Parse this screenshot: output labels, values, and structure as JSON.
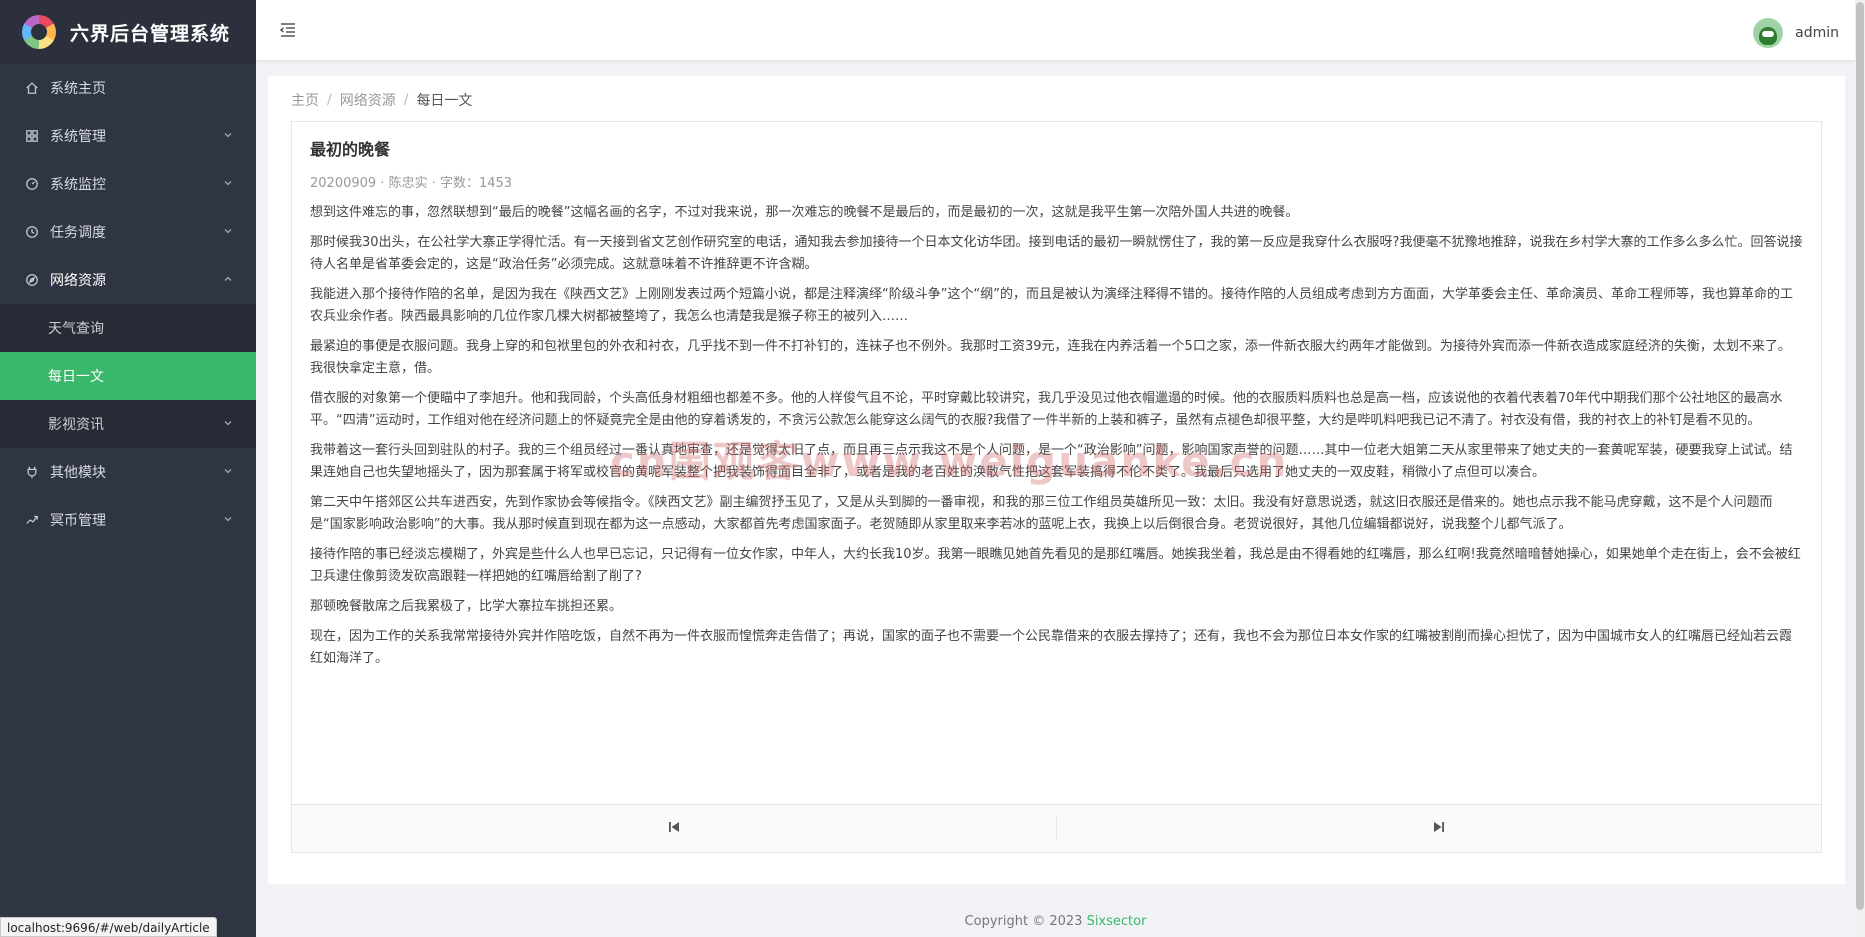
{
  "app": {
    "title": "六界后台管理系统"
  },
  "sidebar": {
    "items": [
      {
        "label": "系统主页",
        "icon": "home-icon"
      },
      {
        "label": "系统管理",
        "icon": "grid-icon"
      },
      {
        "label": "系统监控",
        "icon": "dashboard-icon"
      },
      {
        "label": "任务调度",
        "icon": "clock-icon"
      },
      {
        "label": "网络资源",
        "icon": "compass-icon",
        "open": true,
        "children": [
          {
            "label": "天气查询"
          },
          {
            "label": "每日一文",
            "active": true
          },
          {
            "label": "影视资讯"
          }
        ]
      },
      {
        "label": "其他模块",
        "icon": "plug-icon"
      },
      {
        "label": "冥币管理",
        "icon": "trend-icon"
      }
    ]
  },
  "header": {
    "user_name": "admin"
  },
  "breadcrumb": {
    "home": "主页",
    "section": "网络资源",
    "current": "每日一文",
    "separator": "/"
  },
  "article": {
    "title": "最初的晚餐",
    "meta": "20200909 · 陈忠实 · 字数：1453",
    "paragraphs": [
      "想到这件难忘的事，忽然联想到“最后的晚餐”这幅名画的名字，不过对我来说，那一次难忘的晚餐不是最后的，而是最初的一次，这就是我平生第一次陪外国人共进的晚餐。",
      "那时候我30出头，在公社学大寨正学得忙活。有一天接到省文艺创作研究室的电话，通知我去参加接待一个日本文化访华团。接到电话的最初一瞬就愣住了，我的第一反应是我穿什么衣服呀?我便毫不犹豫地推辞，说我在乡村学大寨的工作多么多么忙。回答说接待人名单是省革委会定的，这是“政治任务”必须完成。这就意味着不许推辞更不许含糊。",
      "我能进入那个接待作陪的名单，是因为我在《陕西文艺》上刚刚发表过两个短篇小说，都是注释演绎“阶级斗争”这个“纲”的，而且是被认为演绎注释得不错的。接待作陪的人员组成考虑到方方面面，大学革委会主任、革命演员、革命工程师等，我也算革命的工农兵业余作者。陕西最具影响的几位作家几棵大树都被整垮了，我怎么也清楚我是猴子称王的被列入……",
      "最紧迫的事便是衣服问题。我身上穿的和包袱里包的外衣和衬衣，几乎找不到一件不打补钉的，连袜子也不例外。我那时工资39元，连我在内养活着一个5口之家，添一件新衣服大约两年才能做到。为接待外宾而添一件新衣造成家庭经济的失衡，太划不来了。我很快拿定主意，借。",
      "借衣服的对象第一个便瞄中了李旭升。他和我同龄，个头高低身材粗细也都差不多。他的人样俊气且不论，平时穿戴比较讲究，我几乎没见过他衣帽邋遢的时候。他的衣服质料质料也总是高一档，应该说他的衣着代表着70年代中期我们那个公社地区的最高水平。“四清”运动时，工作组对他在经济问题上的怀疑竟完全是由他的穿着诱发的，不贪污公款怎么能穿这么阔气的衣服?我借了一件半新的上装和裤子，虽然有点褪色却很平整，大约是哔叽料吧我已记不清了。衬衣没有借，我的衬衣上的补钉是看不见的。",
      "我带着这一套行头回到驻队的村子。我的三个组员经过一番认真地审查，还是觉得太旧了点，而且再三点示我这不是个人问题，是一个“政治影响”问题，影响国家声誉的问题……其中一位老大姐第二天从家里带来了她丈夫的一套黄呢军装，硬要我穿上试试。结果连她自己也失望地摇头了，因为那套属于将军或校官的黄呢军装整个把我装饰得面目全非了，或者是我的老百姓的涣散气性把这套军装搞得不伦不类了。我最后只选用了她丈夫的一双皮鞋，稍微小了点但可以凑合。",
      "第二天中午搭郊区公共车进西安，先到作家协会等候指令。《陕西文艺》副主编贺抒玉见了，又是从头到脚的一番审视，和我的那三位工作组员英雄所见一致：太旧。我没有好意思说透，就这旧衣服还是借来的。她也点示我不能马虎穿戴，这不是个人问题而是“国家影响政治影响”的大事。我从那时候直到现在都为这一点感动，大家都首先考虑国家面子。老贺随即从家里取来李若冰的蓝呢上衣，我换上以后倒很合身。老贺说很好，其他几位编辑都说好，说我整个儿都气派了。",
      "接待作陪的事已经淡忘模糊了，外宾是些什么人也早已忘记，只记得有一位女作家，中年人，大约长我10岁。我第一眼瞧见她首先看见的是那红嘴唇。她挨我坐着，我总是由不得看她的红嘴唇，那么红啊!我竟然暗暗替她操心，如果她单个走在街上，会不会被红卫兵逮住像剪烫发砍高跟鞋一样把她的红嘴唇给割了削了?",
      "那顿晚餐散席之后我累极了，比学大寨拉车挑担还累。",
      "现在，因为工作的关系我常常接待外宾并作陪吃饭，自然不再为一件衣服而惶慌奔走告借了；再说，国家的面子也不需要一个公民靠借来的衣服去撑持了；还有，我也不会为那位日本女作家的红嘴被割削而操心担忧了，因为中国城市女人的红嘴唇已经灿若云霞红如海洋了。"
    ]
  },
  "footer": {
    "copyright": "Copyright © 2023",
    "brand": "Sixsector"
  },
  "watermark": "cn围观客www.weiguanke.cn",
  "status_bar": {
    "url": "localhost:9696/#/web/dailyArticle"
  },
  "colors": {
    "sidebar_bg": "#2f3542",
    "accent": "#3ab76a"
  }
}
